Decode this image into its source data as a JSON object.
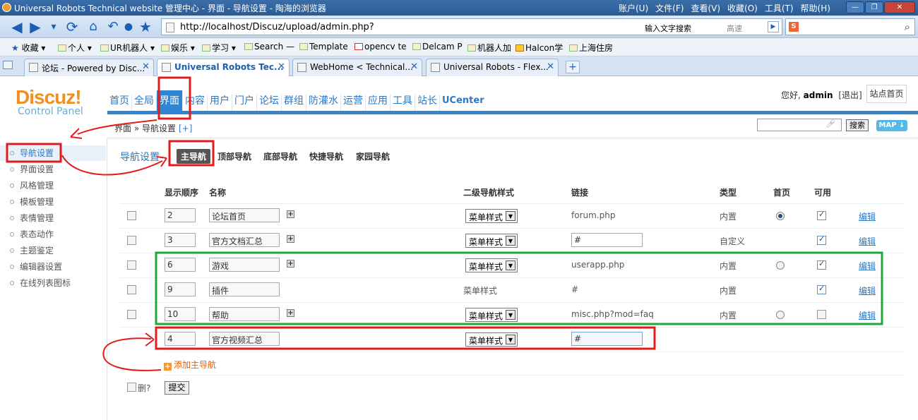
{
  "browser": {
    "title": "Universal Robots Technical website 管理中心 - 界面 - 导航设置 - 陶海的浏览器",
    "menu": [
      "账户(U)",
      "文件(F)",
      "查看(V)",
      "收藏(O)",
      "工具(T)",
      "帮助(H)"
    ],
    "url": "http://localhost/Discuz/upload/admin.php?",
    "search_hint": "输入文字搜索",
    "speed_label": "高速",
    "favorites": [
      "收藏",
      "个人",
      "UR机器人",
      "娱乐",
      "学习",
      "Search —",
      "Template",
      "opencv te",
      "Delcam P",
      "机器人加",
      "Halcon学",
      "上海住房"
    ],
    "tabs": [
      {
        "label": "论坛 - Powered by Disc..."
      },
      {
        "label": "Universal Robots Tec..."
      },
      {
        "label": "WebHome < Technical..."
      },
      {
        "label": "Universal Robots - Flex..."
      }
    ]
  },
  "header": {
    "logo": "Discuz!",
    "logo_sub": "Control Panel",
    "nav": [
      "首页",
      "全局",
      "界面",
      "内容",
      "用户",
      "门户",
      "论坛",
      "群组",
      "防灌水",
      "运营",
      "应用",
      "工具",
      "站长",
      "UCenter"
    ],
    "greet_prefix": "您好,",
    "username": "admin",
    "logout": "[退出]",
    "site_home": "站点首页"
  },
  "crumb": {
    "path": "界面 » 导航设置",
    "plus": "[+]",
    "search_btn": "搜索",
    "map_btn": "MAP ↓"
  },
  "sidebar": [
    "导航设置",
    "界面设置",
    "风格管理",
    "模板管理",
    "表情管理",
    "表态动作",
    "主题鉴定",
    "编辑器设置",
    "在线列表图标"
  ],
  "subnav": {
    "title": "导航设置",
    "items": [
      "主导航",
      "顶部导航",
      "底部导航",
      "快捷导航",
      "家园导航"
    ]
  },
  "table": {
    "headers": [
      "显示顺序",
      "名称",
      "二级导航样式",
      "链接",
      "类型",
      "首页",
      "可用"
    ],
    "rows": [
      {
        "order": "2",
        "name": "论坛首页",
        "style": "菜单样式",
        "link": "forum.php",
        "type": "内置",
        "edit": "编辑"
      },
      {
        "order": "3",
        "name": "官方文档汇总",
        "style": "菜单样式",
        "link": "#",
        "type": "自定义",
        "edit": "编辑"
      },
      {
        "order": "6",
        "name": "游戏",
        "style": "菜单样式",
        "link": "userapp.php",
        "type": "内置",
        "edit": "编辑"
      },
      {
        "order": "9",
        "name": "插件",
        "style": "菜单样式",
        "link": "#",
        "type": "内置",
        "edit": "编辑"
      },
      {
        "order": "10",
        "name": "帮助",
        "style": "菜单样式",
        "link": "misc.php?mod=faq",
        "type": "内置",
        "edit": "编辑"
      },
      {
        "order": "4",
        "name": "官方视频汇总",
        "style": "菜单样式",
        "link": "#"
      }
    ],
    "add_label": "添加主导航",
    "delete_label": "删?",
    "submit_label": "提交"
  }
}
